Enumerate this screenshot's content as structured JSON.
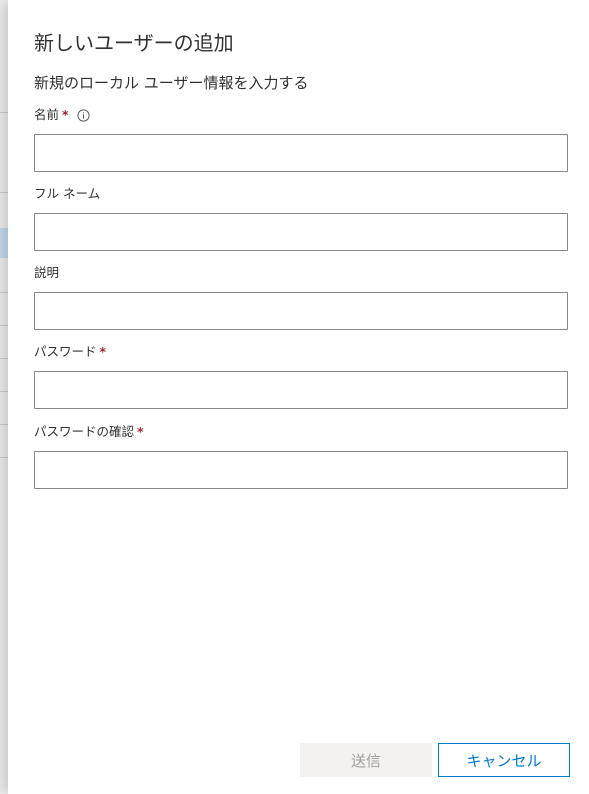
{
  "panel": {
    "title": "新しいユーザーの追加",
    "subtitle": "新規のローカル ユーザー情報を入力する"
  },
  "fields": {
    "name": {
      "label": "名前",
      "required_mark": "*",
      "value": "",
      "icon": "info-icon"
    },
    "full_name": {
      "label": "フル ネーム",
      "value": ""
    },
    "description": {
      "label": "説明",
      "value": ""
    },
    "password": {
      "label": "パスワード",
      "required_mark": "*",
      "value": ""
    },
    "password_confirm": {
      "label": "パスワードの確認",
      "required_mark": "*",
      "value": ""
    }
  },
  "buttons": {
    "submit": {
      "label": "送信",
      "disabled": true
    },
    "cancel": {
      "label": "キャンセル"
    }
  },
  "colors": {
    "accent": "#0078d4",
    "required": "#a4262c",
    "border": "#8a8886",
    "disabled_bg": "#f3f2f1",
    "disabled_text": "#a19f9d"
  }
}
